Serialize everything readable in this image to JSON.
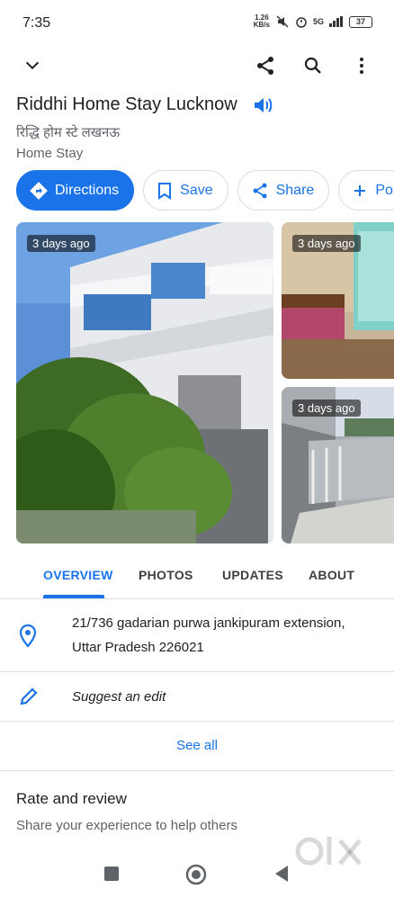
{
  "status_bar": {
    "time": "7:35",
    "net_speed_value": "1.26",
    "net_speed_unit": "KB/s",
    "network": "5G",
    "battery": "37"
  },
  "app_bar": {
    "icons": [
      "chevron-down-icon",
      "share-icon",
      "search-icon",
      "more-vert-icon"
    ]
  },
  "place": {
    "title": "Riddhi Home Stay Lucknow",
    "title_local": "रिद्धि होम स्टे लखनऊ",
    "category": "Home Stay"
  },
  "actions": {
    "directions": "Directions",
    "save": "Save",
    "share": "Share",
    "more": "Po"
  },
  "photos": {
    "main_badge": "3 days ago",
    "top_right_badge": "3 days ago",
    "bottom_right_badge": "3 days ago"
  },
  "tabs": {
    "overview": "OVERVIEW",
    "photos": "PHOTOS",
    "updates": "UPDATES",
    "about": "ABOUT"
  },
  "address": {
    "line1": "21/736 gadarian purwa jankipuram extension,",
    "line2": "Uttar Pradesh 226021"
  },
  "suggest_edit": "Suggest an edit",
  "see_all": "See all",
  "rate": {
    "title": "Rate and review",
    "subtitle": "Share your experience to help others"
  },
  "colors": {
    "accent": "#1a73e8",
    "text": "#202124",
    "secondary": "#5f6368"
  }
}
